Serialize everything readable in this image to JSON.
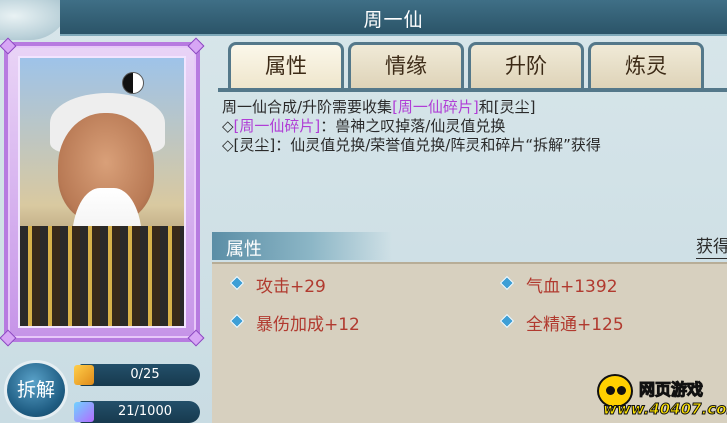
{
  "window": {
    "title": "周一仙"
  },
  "tabs": [
    {
      "label": "属性",
      "active": true
    },
    {
      "label": "情缘",
      "active": false
    },
    {
      "label": "升阶",
      "active": false
    },
    {
      "label": "炼灵",
      "active": false
    }
  ],
  "description": {
    "line1_a": "周一仙合成/升阶需要收集",
    "line1_b": "[周一仙碎片]",
    "line1_c": "和[灵尘]",
    "line2_a": "◇",
    "line2_b": "[周一仙碎片]",
    "line2_c": "：兽神之叹掉落/仙灵值兑换",
    "line3": "◇[灵尘]：仙灵值兑换/荣誉值兑换/阵灵和碎片“拆解”获得"
  },
  "attributes": {
    "header": "属性",
    "obtain_label": "获得",
    "items": [
      {
        "label": "攻击+29"
      },
      {
        "label": "气血+1392"
      },
      {
        "label": "暴伤加成+12"
      },
      {
        "label": "全精通+125"
      }
    ]
  },
  "left_panel": {
    "decompose_button": "拆解",
    "fragments": "0/25",
    "spirit_dust": "21/1000"
  },
  "watermark": {
    "top": "网页游戏",
    "bottom": "www.40407.com"
  },
  "colors": {
    "title_bar": "#2b5468",
    "card_border": "#b77be0",
    "purple_text": "#b03ed6",
    "attribute_text": "#b13a2f",
    "diamond": "#3e9fd6"
  }
}
